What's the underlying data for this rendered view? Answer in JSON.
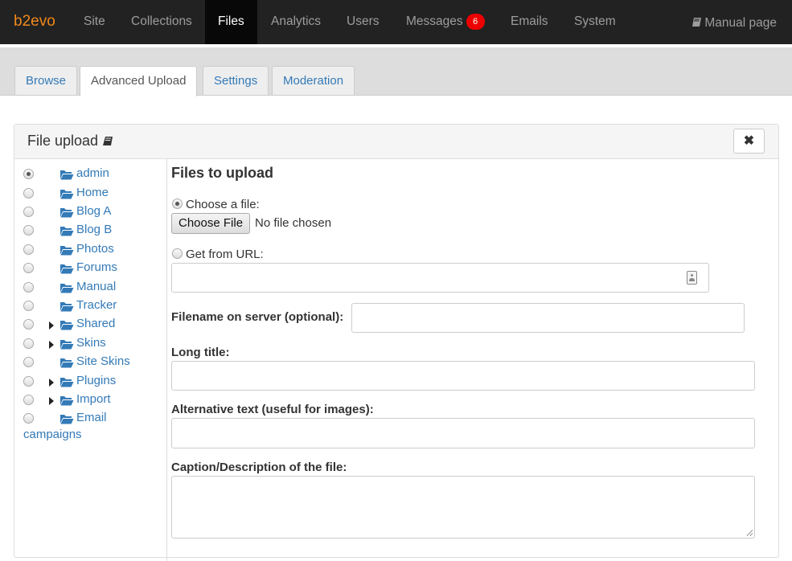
{
  "topnav": {
    "brand": "b2evo",
    "items": [
      "Site",
      "Collections",
      "Files",
      "Analytics",
      "Users",
      "Messages",
      "Emails",
      "System"
    ],
    "messages_badge": "6",
    "manual_label": "Manual page"
  },
  "tabs": [
    "Browse",
    "Advanced Upload",
    "Settings",
    "Moderation"
  ],
  "panel": {
    "title": "File upload",
    "close_label": "✖"
  },
  "folders": [
    {
      "label": "admin",
      "expandable": false,
      "selected": true
    },
    {
      "label": "Home",
      "expandable": false,
      "selected": false
    },
    {
      "label": "Blog A",
      "expandable": false,
      "selected": false
    },
    {
      "label": "Blog B",
      "expandable": false,
      "selected": false
    },
    {
      "label": "Photos",
      "expandable": false,
      "selected": false
    },
    {
      "label": "Forums",
      "expandable": false,
      "selected": false
    },
    {
      "label": "Manual",
      "expandable": false,
      "selected": false
    },
    {
      "label": "Tracker",
      "expandable": false,
      "selected": false
    },
    {
      "label": "Shared",
      "expandable": true,
      "selected": false
    },
    {
      "label": "Skins",
      "expandable": true,
      "selected": false
    },
    {
      "label": "Site Skins",
      "expandable": false,
      "selected": false
    },
    {
      "label": "Plugins",
      "expandable": true,
      "selected": false
    },
    {
      "label": "Import",
      "expandable": true,
      "selected": false
    },
    {
      "label": "Email",
      "label_line2": "campaigns",
      "expandable": false,
      "selected": false
    }
  ],
  "form": {
    "heading": "Files to upload",
    "choose_file_label": "Choose a file:",
    "choose_file_button": "Choose File",
    "no_file_text": "No file chosen",
    "url_label": "Get from URL:",
    "url_value": "",
    "filename_label": "Filename on server (optional):",
    "filename_value": "",
    "long_title_label": "Long title:",
    "long_title_value": "",
    "alt_label": "Alternative text (useful for images):",
    "alt_value": "",
    "caption_label": "Caption/Description of the file:",
    "caption_value": ""
  },
  "colors": {
    "nav_bg": "#222222",
    "brand": "#f0891a",
    "link": "#337ab7",
    "badge": "#ee0000"
  }
}
